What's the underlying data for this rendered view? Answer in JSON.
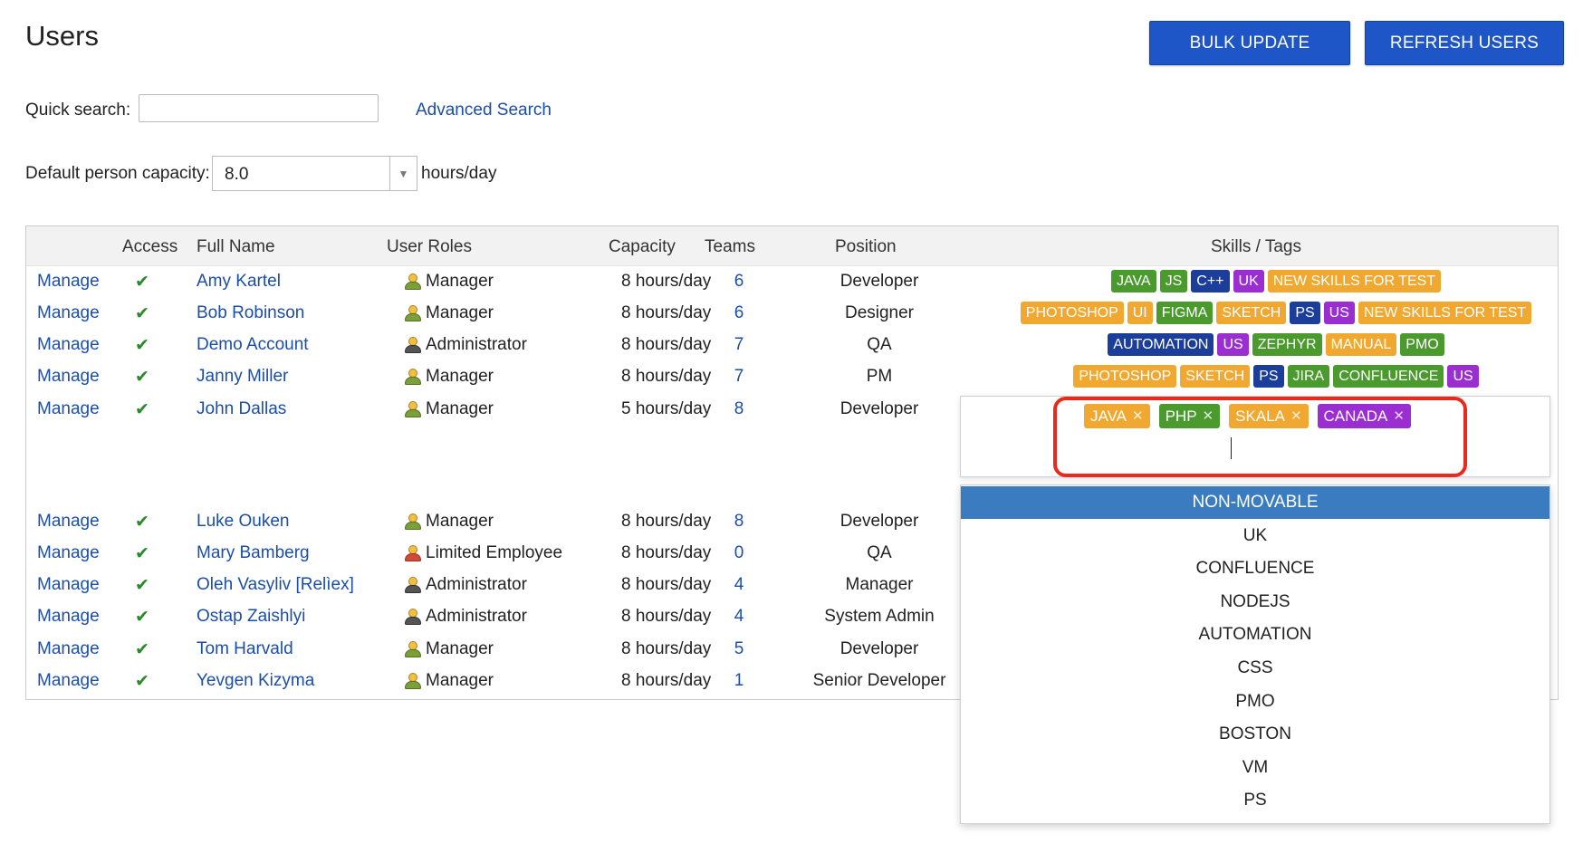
{
  "page": {
    "title": "Users"
  },
  "toolbar": {
    "bulk_update": "BULK UPDATE",
    "refresh_users": "REFRESH USERS"
  },
  "search": {
    "label": "Quick search:",
    "value": "",
    "advanced": "Advanced Search"
  },
  "capacity": {
    "label": "Default person capacity:",
    "value": "8.0",
    "unit": "hours/day"
  },
  "table": {
    "headers": {
      "access": "Access",
      "full_name": "Full Name",
      "user_roles": "User Roles",
      "capacity": "Capacity",
      "teams": "Teams",
      "position": "Position",
      "skills": "Skills / Tags"
    },
    "manage_label": "Manage",
    "access_mark": "✔",
    "rows": [
      {
        "name": "Amy Kartel",
        "role": "Manager",
        "role_icon": "manager",
        "capacity": "8 hours/day",
        "teams": "6",
        "position": "Developer",
        "tags": [
          {
            "t": "JAVA",
            "c": "#4a9a2e"
          },
          {
            "t": "JS",
            "c": "#4a9a2e"
          },
          {
            "t": "C++",
            "c": "#1a3e9a"
          },
          {
            "t": "UK",
            "c": "#9a2ed0"
          },
          {
            "t": "NEW SKILLS FOR TEST",
            "c": "#f0a830"
          }
        ]
      },
      {
        "name": "Bob Robinson",
        "role": "Manager",
        "role_icon": "manager",
        "capacity": "8 hours/day",
        "teams": "6",
        "position": "Designer",
        "tags": [
          {
            "t": "PHOTOSHOP",
            "c": "#f0a830"
          },
          {
            "t": "UI",
            "c": "#f0a830"
          },
          {
            "t": "FIGMA",
            "c": "#4a9a2e"
          },
          {
            "t": "SKETCH",
            "c": "#f0a830"
          },
          {
            "t": "PS",
            "c": "#1a3e9a"
          },
          {
            "t": "US",
            "c": "#9a2ed0"
          },
          {
            "t": "NEW SKILLS FOR TEST",
            "c": "#f0a830"
          }
        ]
      },
      {
        "name": "Demo Account",
        "role": "Administrator",
        "role_icon": "admin",
        "capacity": "8 hours/day",
        "teams": "7",
        "position": "QA",
        "tags": [
          {
            "t": "AUTOMATION",
            "c": "#1a3e9a"
          },
          {
            "t": "US",
            "c": "#9a2ed0"
          },
          {
            "t": "ZEPHYR",
            "c": "#4a9a2e"
          },
          {
            "t": "MANUAL",
            "c": "#f0a830"
          },
          {
            "t": "PMO",
            "c": "#4a9a2e"
          }
        ]
      },
      {
        "name": "Janny Miller",
        "role": "Manager",
        "role_icon": "manager",
        "capacity": "8 hours/day",
        "teams": "7",
        "position": "PM",
        "tags": [
          {
            "t": "PHOTOSHOP",
            "c": "#f0a830"
          },
          {
            "t": "SKETCH",
            "c": "#f0a830"
          },
          {
            "t": "PS",
            "c": "#1a3e9a"
          },
          {
            "t": "JIRA",
            "c": "#4a9a2e"
          },
          {
            "t": "CONFLUENCE",
            "c": "#4a9a2e"
          },
          {
            "t": "US",
            "c": "#9a2ed0"
          }
        ]
      },
      {
        "name": "John Dallas",
        "role": "Manager",
        "role_icon": "manager",
        "capacity": "5 hours/day",
        "teams": "8",
        "position": "Developer",
        "tags": []
      },
      {
        "name": "Luke Ouken",
        "role": "Manager",
        "role_icon": "manager",
        "capacity": "8 hours/day",
        "teams": "8",
        "position": "Developer",
        "tags": []
      },
      {
        "name": "Mary Bamberg",
        "role": "Limited Employee",
        "role_icon": "limited",
        "capacity": "8 hours/day",
        "teams": "0",
        "position": "QA",
        "tags": []
      },
      {
        "name": "Oleh Vasyliv [Relìex]",
        "role": "Administrator",
        "role_icon": "admin",
        "capacity": "8 hours/day",
        "teams": "4",
        "position": "Manager",
        "tags": []
      },
      {
        "name": "Ostap Zaishlyi",
        "role": "Administrator",
        "role_icon": "admin",
        "capacity": "8 hours/day",
        "teams": "4",
        "position": "System Admin",
        "tags": []
      },
      {
        "name": "Tom Harvald",
        "role": "Manager",
        "role_icon": "manager",
        "capacity": "8 hours/day",
        "teams": "5",
        "position": "Developer",
        "tags": []
      },
      {
        "name": "Yevgen Kizyma",
        "role": "Manager",
        "role_icon": "manager",
        "capacity": "8 hours/day",
        "teams": "1",
        "position": "Senior Developer",
        "tags": []
      }
    ]
  },
  "tag_editor": {
    "tags": [
      {
        "t": "JAVA",
        "c": "#f0a830"
      },
      {
        "t": "PHP",
        "c": "#4a9a2e"
      },
      {
        "t": "SKALA",
        "c": "#f0a830"
      },
      {
        "t": "CANADA",
        "c": "#9a2ed0"
      }
    ],
    "remove_glyph": "✕",
    "options": [
      "NON-MOVABLE",
      "UK",
      "CONFLUENCE",
      "NODEJS",
      "AUTOMATION",
      "CSS",
      "PMO",
      "BOSTON",
      "VM",
      "PS"
    ],
    "active_index": 0
  },
  "colors": {
    "accent_button": "#1e56c8",
    "link": "#1b4ea8",
    "highlight": "#e8291c",
    "dropdown_active": "#3a7cbf"
  }
}
